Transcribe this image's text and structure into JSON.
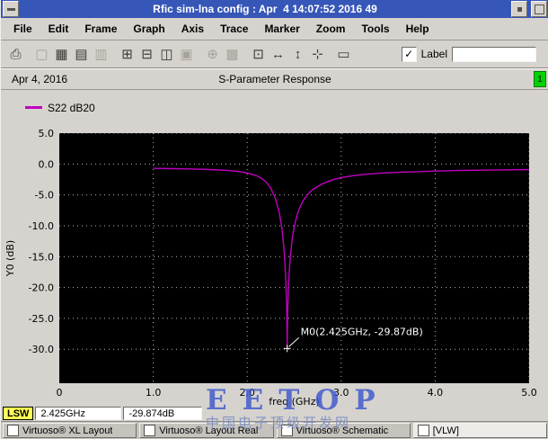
{
  "window": {
    "title": "Rfic sim-lna config : Apr  4 14:07:52 2016 49"
  },
  "menu": {
    "items": [
      "File",
      "Edit",
      "Frame",
      "Graph",
      "Axis",
      "Trace",
      "Marker",
      "Zoom",
      "Tools",
      "Help"
    ]
  },
  "toolbar": {
    "icons": [
      {
        "name": "print-icon",
        "glyph": "⎙",
        "enabled": true,
        "gap": false
      },
      {
        "name": "snapshot-icon",
        "glyph": "▢",
        "enabled": false,
        "gap": true
      },
      {
        "name": "grid-toggle-icon",
        "glyph": "▦",
        "enabled": true,
        "gap": false
      },
      {
        "name": "strip-chart-icon",
        "glyph": "▤",
        "enabled": true,
        "gap": false
      },
      {
        "name": "overlay-mode-icon",
        "glyph": "▥",
        "enabled": false,
        "gap": false
      },
      {
        "name": "new-subwindow-icon",
        "glyph": "⊞",
        "enabled": true,
        "gap": true
      },
      {
        "name": "delete-subwindow-icon",
        "glyph": "⊟",
        "enabled": true,
        "gap": false
      },
      {
        "name": "split-window-icon",
        "glyph": "◫",
        "enabled": true,
        "gap": false
      },
      {
        "name": "combine-window-icon",
        "glyph": "▣",
        "enabled": false,
        "gap": false
      },
      {
        "name": "smith-grid-icon",
        "glyph": "⊕",
        "enabled": false,
        "gap": true
      },
      {
        "name": "log-grid-icon",
        "glyph": "▩",
        "enabled": false,
        "gap": false
      },
      {
        "name": "zoom-fit-icon",
        "glyph": "⊡",
        "enabled": true,
        "gap": true
      },
      {
        "name": "zoom-x-icon",
        "glyph": "↔",
        "enabled": true,
        "gap": false
      },
      {
        "name": "zoom-y-icon",
        "glyph": "↕",
        "enabled": true,
        "gap": false
      },
      {
        "name": "pan-icon",
        "glyph": "⊹",
        "enabled": true,
        "gap": false
      },
      {
        "name": "redraw-icon",
        "glyph": "▭",
        "enabled": true,
        "gap": true
      }
    ],
    "label_checkbox": {
      "label": "Label",
      "checked": true,
      "glyph": "✓"
    },
    "label_input_value": ""
  },
  "graph_header": {
    "date": "Apr 4, 2016",
    "title": "S-Parameter Response",
    "window_number": "1"
  },
  "legend": {
    "series": [
      {
        "label": "S22 dB20",
        "color": "#bf00bf"
      }
    ]
  },
  "chart_data": {
    "type": "line",
    "title": "S-Parameter Response",
    "xlabel": "freq (GHz)",
    "ylabel": "Y0 (dB)",
    "xlim": [
      0,
      5
    ],
    "ylim": [
      -35.5,
      5
    ],
    "grid": true,
    "plot_bg": "#000000",
    "x_tick_values": [
      0,
      1.0,
      2.0,
      3.0,
      4.0,
      5.0
    ],
    "x_tick_labels": [
      "0",
      "1.0",
      "2.0",
      "3.0",
      "4.0",
      "5.0"
    ],
    "y_tick_values": [
      5.0,
      0.0,
      -5.0,
      -10.0,
      -15.0,
      -20.0,
      -25.0,
      -30.0
    ],
    "y_tick_labels": [
      "5.0",
      "0.0",
      "-5.0",
      "-10.0",
      "-15.0",
      "-20.0",
      "-25.0",
      "-30.0"
    ],
    "series": [
      {
        "name": "S22 dB20",
        "color": "#bf00bf",
        "x": [
          1.0,
          1.2,
          1.4,
          1.6,
          1.8,
          1.9,
          2.0,
          2.1,
          2.15,
          2.2,
          2.25,
          2.3,
          2.34,
          2.37,
          2.39,
          2.4,
          2.41,
          2.42,
          2.425,
          2.43,
          2.44,
          2.45,
          2.46,
          2.48,
          2.5,
          2.53,
          2.56,
          2.6,
          2.65,
          2.7,
          2.8,
          2.9,
          3.0,
          3.1,
          3.2,
          3.4,
          3.6,
          3.8,
          4.0,
          4.25,
          4.5,
          4.75,
          5.0
        ],
        "y": [
          -0.7,
          -0.75,
          -0.8,
          -0.9,
          -1.05,
          -1.2,
          -1.45,
          -1.9,
          -2.3,
          -2.9,
          -3.9,
          -5.6,
          -7.8,
          -10.5,
          -13.5,
          -15.8,
          -18.8,
          -23.0,
          -29.87,
          -24.0,
          -19.4,
          -16.8,
          -14.8,
          -12.0,
          -10.2,
          -8.3,
          -7.0,
          -5.8,
          -4.8,
          -4.1,
          -3.2,
          -2.6,
          -2.2,
          -1.95,
          -1.75,
          -1.5,
          -1.35,
          -1.25,
          -1.15,
          -1.05,
          -1.0,
          -0.95,
          -0.9
        ]
      }
    ],
    "marker": {
      "label": "M0(2.425GHz, -29.87dB)",
      "x": 2.425,
      "y": -29.87
    }
  },
  "status": {
    "mode": "LSW",
    "x_value": "2.425GHz",
    "y_value": "-29.874dB"
  },
  "taskbar": {
    "windows": [
      "Virtuoso® XL Layout",
      "Virtuoso® Layout Real",
      "Virtuoso® Schematic",
      "[VLW]"
    ],
    "active_index": 3
  },
  "watermark": {
    "line1": "EETOP",
    "line2": "中国电子顶级开发网"
  }
}
